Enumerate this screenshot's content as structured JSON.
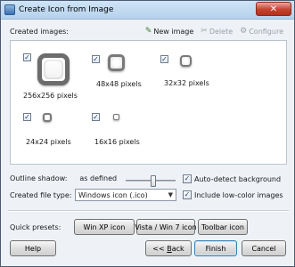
{
  "window": {
    "title": "Create Icon from Image",
    "close_symbol": "✕"
  },
  "section": {
    "created_label": "Created images:"
  },
  "toolbar": {
    "new_image": "New image",
    "delete": "Delete",
    "configure": "Configure"
  },
  "images": [
    {
      "label": "256x256 pixels",
      "checked": true
    },
    {
      "label": "48x48 pixels",
      "checked": true
    },
    {
      "label": "32x32 pixels",
      "checked": true
    },
    {
      "label": "24x24 pixels",
      "checked": true
    },
    {
      "label": "16x16 pixels",
      "checked": true
    }
  ],
  "options": {
    "outline_label": "Outline shadow:",
    "outline_value": "as defined",
    "auto_detect": "Auto-detect background",
    "filetype_label": "Created file type:",
    "filetype_value": "Windows icon (.ico)",
    "low_color": "Include low-color images"
  },
  "presets": {
    "label": "Quick presets:",
    "winxp": "Win XP icon",
    "vista": "Vista / Win 7 icon",
    "toolbar": "Toolbar icon"
  },
  "buttons": {
    "help": "Help",
    "back_prefix": "<< ",
    "back_key": "B",
    "back_rest": "ack",
    "finish": "Finish",
    "cancel": "Cancel"
  },
  "checkmark": "✓"
}
